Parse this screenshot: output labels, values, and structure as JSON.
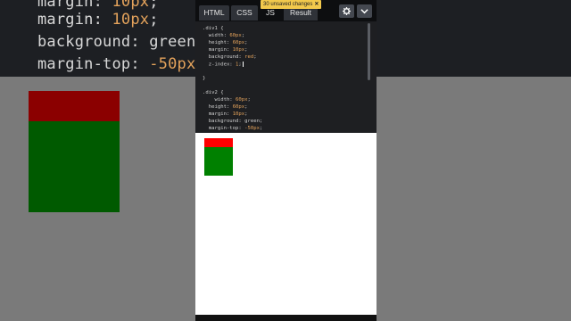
{
  "tabs": {
    "html": "HTML",
    "css": "CSS",
    "js": "JS",
    "result": "Result"
  },
  "notice": {
    "unsaved": "30 unsaved changes",
    "close": "✕"
  },
  "icons": {
    "settings": "gear-icon",
    "menu": "chevron-down-icon"
  },
  "code": [
    {
      "text": ".div1 {"
    },
    {
      "prop": "  width: ",
      "val": "60px",
      "end": ";"
    },
    {
      "prop": "  height: ",
      "val": "60px",
      "end": ";"
    },
    {
      "prop": "  margin: ",
      "val": "10px",
      "end": ";"
    },
    {
      "prop": "  background: ",
      "val": "red",
      "end": ";"
    },
    {
      "prop": "  z-index: ",
      "val": "1",
      "end": ";"
    },
    {
      "text": ""
    },
    {
      "text": "}"
    },
    {
      "text": ""
    },
    {
      "text": ""
    },
    {
      "text": ".div2 {"
    },
    {
      "prop": "    width: ",
      "val": "60px",
      "end": ";"
    },
    {
      "prop": "  height: ",
      "val": "60px",
      "end": ";"
    },
    {
      "prop": "  margin: ",
      "val": "10px",
      "end": ";"
    },
    {
      "prop": "  background: ",
      "val": "green",
      "end": ";"
    },
    {
      "prop": "  margin-top: ",
      "val": "-50px",
      "end": ";"
    }
  ],
  "background_code": [
    {
      "prop": "margin: ",
      "val": "10px",
      "end": ";"
    },
    {
      "prop": "background: ",
      "val": "green",
      "end": ";"
    },
    {
      "prop": "margin-top: ",
      "val": "-50px",
      "end": ";"
    }
  ],
  "colors": {
    "div1": "#ff0000",
    "div2": "#008000",
    "notice": "#f2c94c",
    "value": "#e3a25b"
  }
}
